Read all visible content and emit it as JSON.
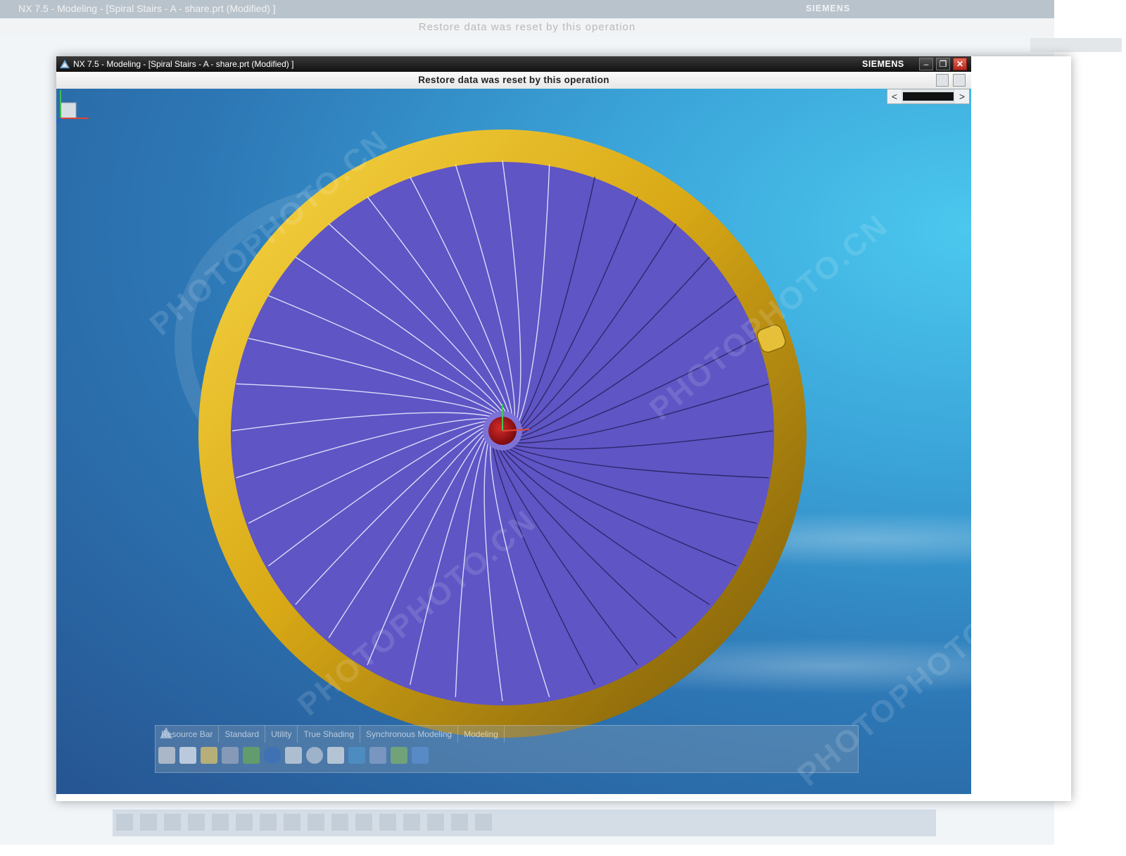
{
  "background_window": {
    "title": "NX 7.5 - Modeling - [Spiral Stairs - A - share.prt (Modified) ]",
    "brand": "SIEMENS",
    "status": "Restore data was reset by this operation"
  },
  "window": {
    "title": "NX 7.5 - Modeling - [Spiral Stairs - A - share.prt (Modified) ]",
    "brand": "SIEMENS",
    "buttons": {
      "minimize": "‒",
      "restore": "❐",
      "close": "✕"
    },
    "status": "Restore data was reset by this operation"
  },
  "scroll": {
    "left_arrow": "<",
    "right_arrow": ">"
  },
  "toolbar": {
    "tabs": [
      "Resource Bar",
      "Standard",
      "Utility",
      "True Shading",
      "Synchronous Modeling",
      "Modeling"
    ],
    "icons": [
      "new-icon",
      "assembly-icon",
      "constraint-icon",
      "part-navigator-icon",
      "info-icon",
      "document-icon",
      "history-icon",
      "list-icon",
      "analysis-icon",
      "cursor-icon",
      "roles-icon",
      "image-icon"
    ]
  },
  "model": {
    "name": "Spiral Stairs",
    "step_count": 36,
    "colors": {
      "steps": "#6a5fcf",
      "rail": "#d9a916",
      "post": "#9c0d12",
      "viewport_top": "#4bc8ee",
      "viewport_bottom": "#265592"
    }
  },
  "watermark": "PHOTOPHOTO.CN"
}
